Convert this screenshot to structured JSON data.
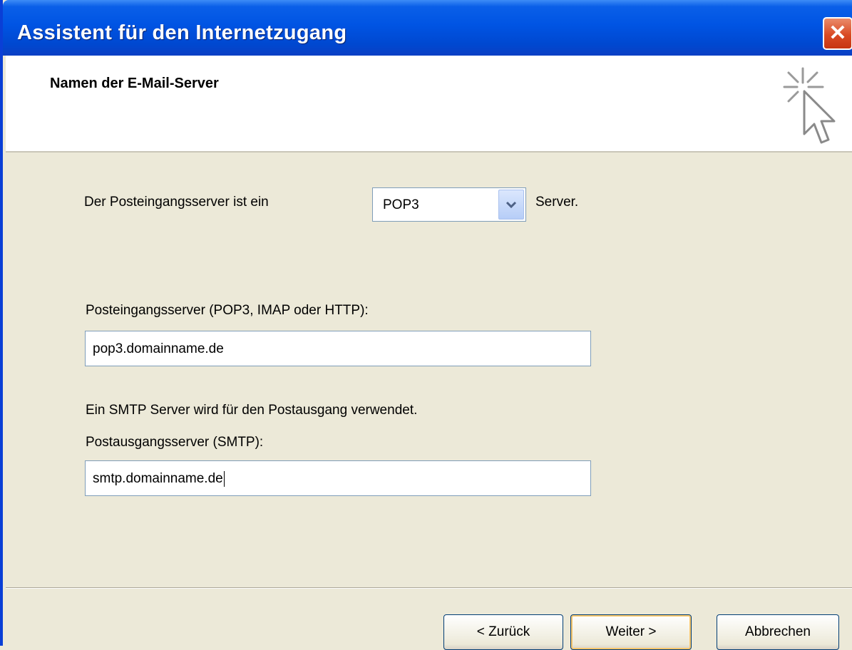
{
  "window": {
    "title": "Assistent für den Internetzugang",
    "close_glyph": "✕"
  },
  "header": {
    "title": "Namen der E-Mail-Server",
    "icon": "wizard-sparkle-cursor-icon"
  },
  "form": {
    "incoming_type_label": "Der Posteingangsserver ist ein",
    "incoming_type_value": "POP3",
    "incoming_type_suffix": "Server.",
    "incoming_server_label": "Posteingangsserver (POP3, IMAP oder HTTP):",
    "incoming_server_value": "pop3.domainname.de",
    "smtp_info": "Ein SMTP Server wird für den Postausgang verwendet.",
    "outgoing_server_label": "Postausgangsserver (SMTP):",
    "outgoing_server_value": "smtp.domainname.de"
  },
  "buttons": {
    "back": "< Zurück",
    "next": "Weiter >",
    "cancel": "Abbrechen"
  },
  "colors": {
    "titlebar": "#0054e3",
    "dialog_bg": "#ece9d8",
    "close_button": "#d94a24"
  }
}
